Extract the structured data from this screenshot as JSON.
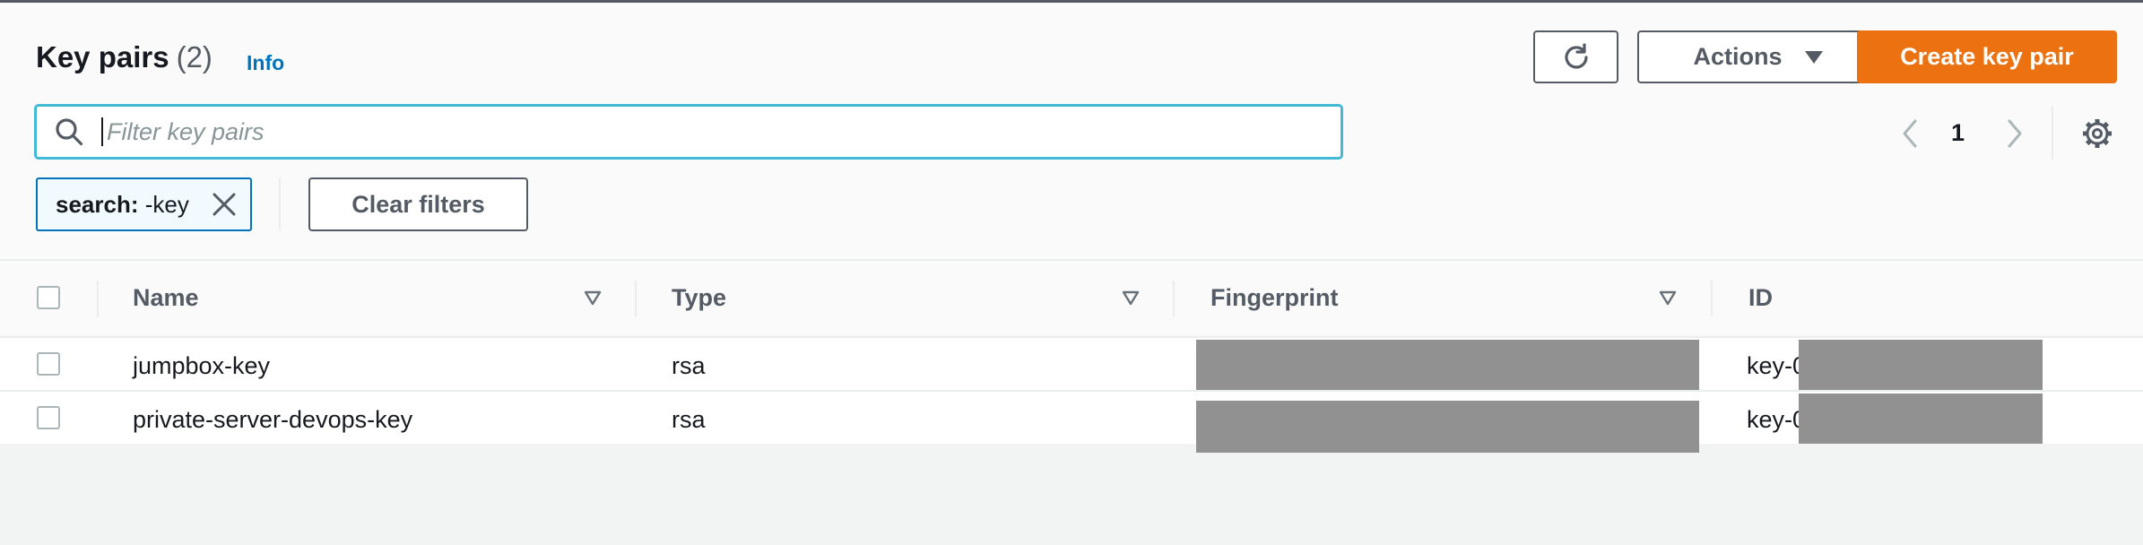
{
  "header": {
    "title": "Key pairs",
    "count": "(2)",
    "info_link": "Info",
    "actions_label": "Actions",
    "create_label": "Create key pair"
  },
  "search": {
    "placeholder": "Filter key pairs",
    "value": ""
  },
  "pagination": {
    "current_page": "1"
  },
  "filter_token": {
    "key": "search:",
    "value": "-key"
  },
  "clear_filters_label": "Clear filters",
  "table": {
    "columns": [
      "Name",
      "Type",
      "Fingerprint",
      "ID"
    ],
    "rows": [
      {
        "name": "jumpbox-key",
        "type": "rsa",
        "fingerprint": "",
        "id_prefix": "key-0"
      },
      {
        "name": "private-server-devops-key",
        "type": "rsa",
        "fingerprint": "",
        "id_prefix": "key-0"
      }
    ]
  },
  "colors": {
    "accent_orange": "#ec7211",
    "link_blue": "#0073bb",
    "focus_cyan": "#44b9d6",
    "redaction_gray": "#919191"
  },
  "icons": [
    "refresh-icon",
    "caret-down-icon",
    "search-icon",
    "chevron-left-icon",
    "chevron-right-icon",
    "settings-gear-icon",
    "close-icon",
    "sort-icon"
  ]
}
